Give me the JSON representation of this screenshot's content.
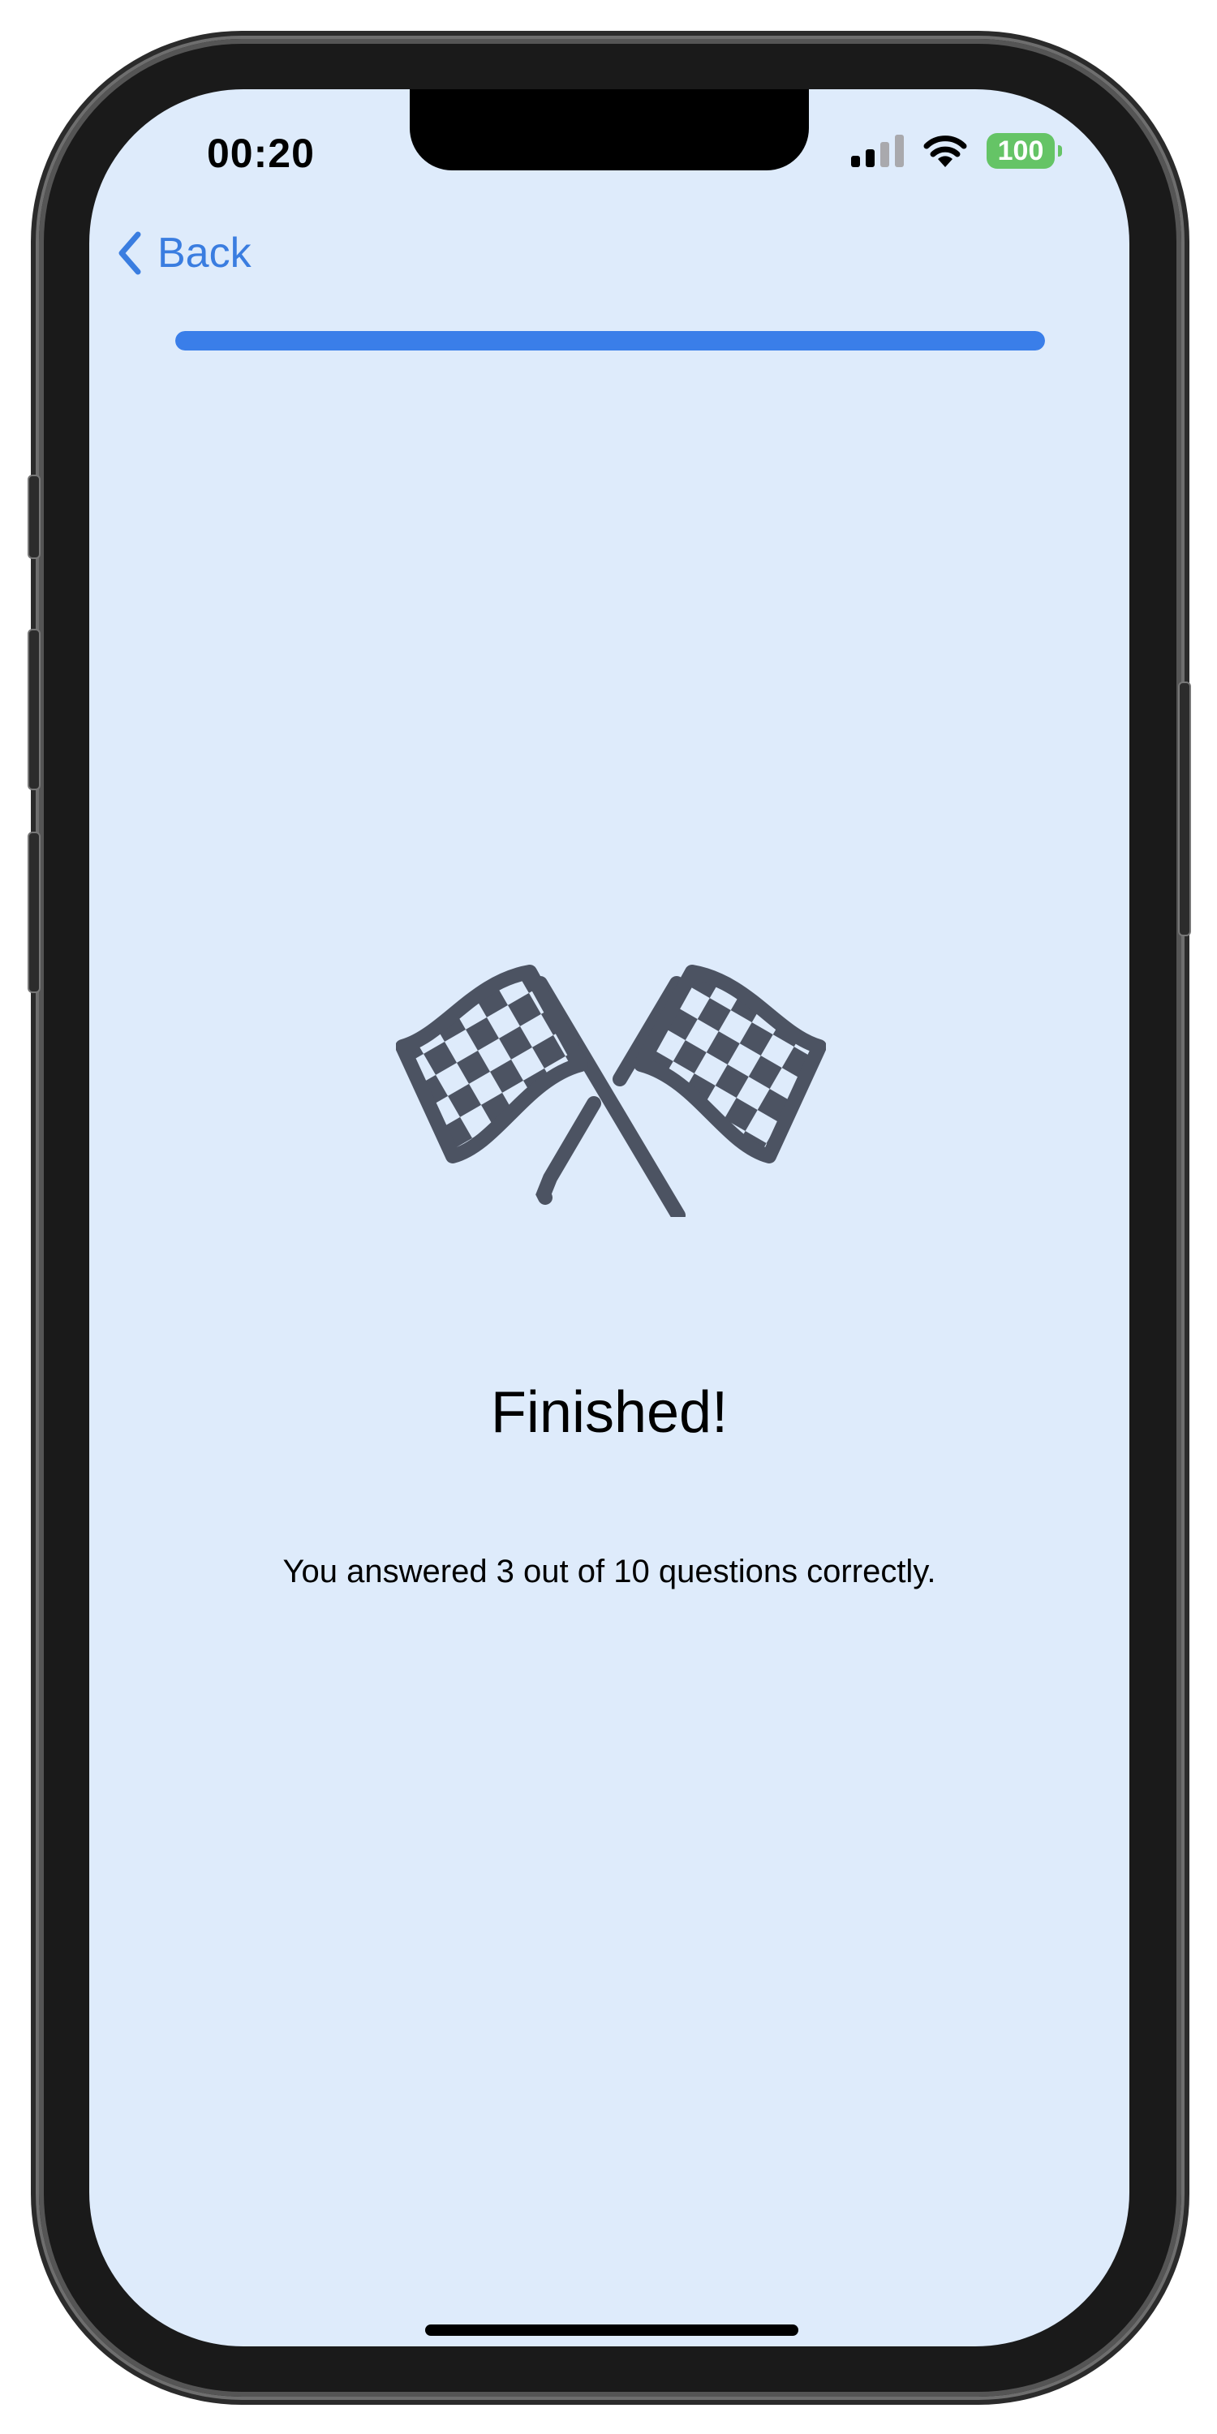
{
  "status_bar": {
    "time": "00:20",
    "battery": "100",
    "signal_icon": "cellular-signal-icon",
    "wifi_icon": "wifi-icon"
  },
  "nav": {
    "back_label": "Back",
    "back_icon": "chevron-left-icon"
  },
  "progress": {
    "fraction": 1.0
  },
  "result": {
    "icon": "checkered-flags-icon",
    "title": "Finished!",
    "summary": "You answered 3 out of 10 questions correctly."
  },
  "colors": {
    "background": "#deebfb",
    "accent": "#3a7ee9",
    "icon": "#4c5362",
    "battery": "#65c466"
  }
}
